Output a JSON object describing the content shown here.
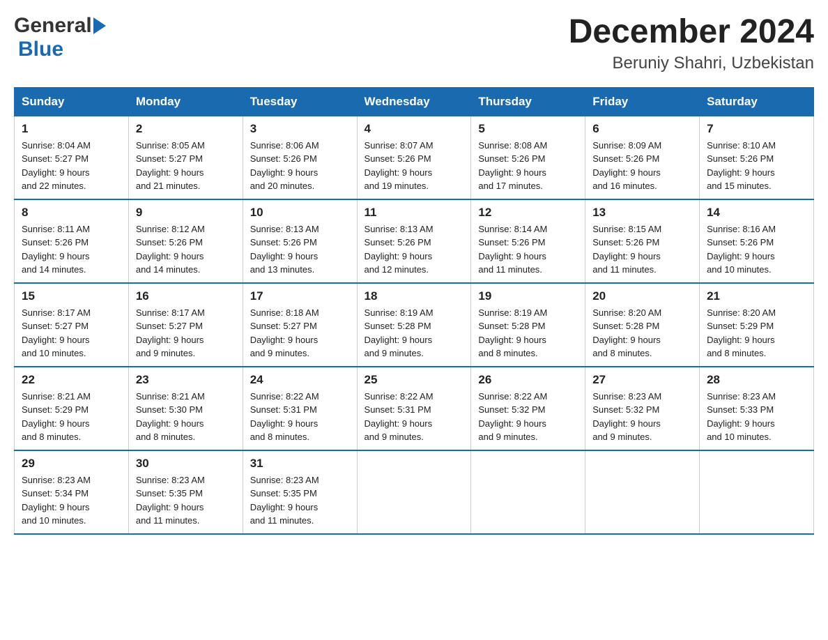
{
  "header": {
    "logo_general": "General",
    "logo_blue": "Blue",
    "month_title": "December 2024",
    "location": "Beruniy Shahri, Uzbekistan"
  },
  "days_of_week": [
    "Sunday",
    "Monday",
    "Tuesday",
    "Wednesday",
    "Thursday",
    "Friday",
    "Saturday"
  ],
  "weeks": [
    [
      {
        "day": "1",
        "sunrise": "8:04 AM",
        "sunset": "5:27 PM",
        "daylight": "9 hours and 22 minutes."
      },
      {
        "day": "2",
        "sunrise": "8:05 AM",
        "sunset": "5:27 PM",
        "daylight": "9 hours and 21 minutes."
      },
      {
        "day": "3",
        "sunrise": "8:06 AM",
        "sunset": "5:26 PM",
        "daylight": "9 hours and 20 minutes."
      },
      {
        "day": "4",
        "sunrise": "8:07 AM",
        "sunset": "5:26 PM",
        "daylight": "9 hours and 19 minutes."
      },
      {
        "day": "5",
        "sunrise": "8:08 AM",
        "sunset": "5:26 PM",
        "daylight": "9 hours and 17 minutes."
      },
      {
        "day": "6",
        "sunrise": "8:09 AM",
        "sunset": "5:26 PM",
        "daylight": "9 hours and 16 minutes."
      },
      {
        "day": "7",
        "sunrise": "8:10 AM",
        "sunset": "5:26 PM",
        "daylight": "9 hours and 15 minutes."
      }
    ],
    [
      {
        "day": "8",
        "sunrise": "8:11 AM",
        "sunset": "5:26 PM",
        "daylight": "9 hours and 14 minutes."
      },
      {
        "day": "9",
        "sunrise": "8:12 AM",
        "sunset": "5:26 PM",
        "daylight": "9 hours and 14 minutes."
      },
      {
        "day": "10",
        "sunrise": "8:13 AM",
        "sunset": "5:26 PM",
        "daylight": "9 hours and 13 minutes."
      },
      {
        "day": "11",
        "sunrise": "8:13 AM",
        "sunset": "5:26 PM",
        "daylight": "9 hours and 12 minutes."
      },
      {
        "day": "12",
        "sunrise": "8:14 AM",
        "sunset": "5:26 PM",
        "daylight": "9 hours and 11 minutes."
      },
      {
        "day": "13",
        "sunrise": "8:15 AM",
        "sunset": "5:26 PM",
        "daylight": "9 hours and 11 minutes."
      },
      {
        "day": "14",
        "sunrise": "8:16 AM",
        "sunset": "5:26 PM",
        "daylight": "9 hours and 10 minutes."
      }
    ],
    [
      {
        "day": "15",
        "sunrise": "8:17 AM",
        "sunset": "5:27 PM",
        "daylight": "9 hours and 10 minutes."
      },
      {
        "day": "16",
        "sunrise": "8:17 AM",
        "sunset": "5:27 PM",
        "daylight": "9 hours and 9 minutes."
      },
      {
        "day": "17",
        "sunrise": "8:18 AM",
        "sunset": "5:27 PM",
        "daylight": "9 hours and 9 minutes."
      },
      {
        "day": "18",
        "sunrise": "8:19 AM",
        "sunset": "5:28 PM",
        "daylight": "9 hours and 9 minutes."
      },
      {
        "day": "19",
        "sunrise": "8:19 AM",
        "sunset": "5:28 PM",
        "daylight": "9 hours and 8 minutes."
      },
      {
        "day": "20",
        "sunrise": "8:20 AM",
        "sunset": "5:28 PM",
        "daylight": "9 hours and 8 minutes."
      },
      {
        "day": "21",
        "sunrise": "8:20 AM",
        "sunset": "5:29 PM",
        "daylight": "9 hours and 8 minutes."
      }
    ],
    [
      {
        "day": "22",
        "sunrise": "8:21 AM",
        "sunset": "5:29 PM",
        "daylight": "9 hours and 8 minutes."
      },
      {
        "day": "23",
        "sunrise": "8:21 AM",
        "sunset": "5:30 PM",
        "daylight": "9 hours and 8 minutes."
      },
      {
        "day": "24",
        "sunrise": "8:22 AM",
        "sunset": "5:31 PM",
        "daylight": "9 hours and 8 minutes."
      },
      {
        "day": "25",
        "sunrise": "8:22 AM",
        "sunset": "5:31 PM",
        "daylight": "9 hours and 9 minutes."
      },
      {
        "day": "26",
        "sunrise": "8:22 AM",
        "sunset": "5:32 PM",
        "daylight": "9 hours and 9 minutes."
      },
      {
        "day": "27",
        "sunrise": "8:23 AM",
        "sunset": "5:32 PM",
        "daylight": "9 hours and 9 minutes."
      },
      {
        "day": "28",
        "sunrise": "8:23 AM",
        "sunset": "5:33 PM",
        "daylight": "9 hours and 10 minutes."
      }
    ],
    [
      {
        "day": "29",
        "sunrise": "8:23 AM",
        "sunset": "5:34 PM",
        "daylight": "9 hours and 10 minutes."
      },
      {
        "day": "30",
        "sunrise": "8:23 AM",
        "sunset": "5:35 PM",
        "daylight": "9 hours and 11 minutes."
      },
      {
        "day": "31",
        "sunrise": "8:23 AM",
        "sunset": "5:35 PM",
        "daylight": "9 hours and 11 minutes."
      },
      null,
      null,
      null,
      null
    ]
  ],
  "labels": {
    "sunrise": "Sunrise:",
    "sunset": "Sunset:",
    "daylight": "Daylight:"
  }
}
